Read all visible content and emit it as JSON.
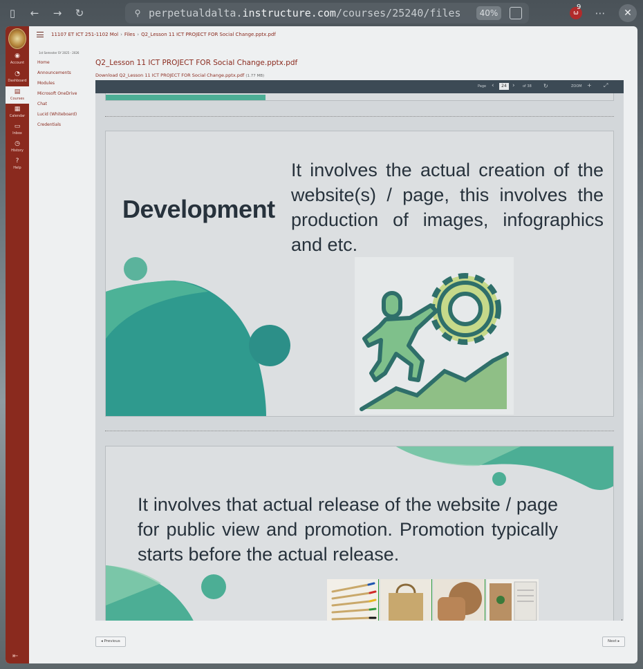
{
  "browser": {
    "url_prefix": "perpetualdalta.",
    "url_domain": "instructure.com",
    "url_path": "/courses/25240/files",
    "zoom": "40%",
    "extension_badge": "9"
  },
  "breadcrumb": {
    "course": "11107 ET ICT 251-1102 Mol",
    "files": "Files",
    "current": "Q2_Lesson 11 ICT PROJECT FOR Social Change.pptx.pdf"
  },
  "global_nav": [
    {
      "label": "Account",
      "icon": "account-icon"
    },
    {
      "label": "Dashboard",
      "icon": "dashboard-icon"
    },
    {
      "label": "Courses",
      "icon": "courses-icon"
    },
    {
      "label": "Calendar",
      "icon": "calendar-icon"
    },
    {
      "label": "Inbox",
      "icon": "inbox-icon"
    },
    {
      "label": "History",
      "icon": "history-icon"
    },
    {
      "label": "Help",
      "icon": "help-icon"
    }
  ],
  "course_nav": {
    "term": "1st Semester SY 2025 - 2026",
    "items": [
      "Home",
      "Announcements",
      "Modules",
      "Microsoft OneDrive",
      "Chat",
      "Lucid (Whiteboard)",
      "Credentials"
    ]
  },
  "file": {
    "title": "Q2_Lesson 11 ICT PROJECT FOR Social Change.pptx.pdf",
    "download_label": "Download Q2_Lesson 11 ICT PROJECT FOR Social Change.pptx.pdf",
    "size": "(1.77 MB)"
  },
  "viewer": {
    "page_label": "Page",
    "page_current": "24",
    "page_total": "of 38",
    "zoom_label": "ZOOM"
  },
  "slides": {
    "development_title": "Development",
    "development_body": "It involves the actual creation of the website(s) / page, this involves the production of images, infographics and etc.",
    "release_body": "It involves that actual release of the website / page for public view and promotion. Promotion typically starts before the actual release."
  },
  "footer": {
    "previous": "◂ Previous",
    "next": "Next ▸"
  },
  "colors": {
    "canvas_red": "#8a2a1e",
    "teal": "#4cae95",
    "dark_teal": "#2c8f88"
  }
}
